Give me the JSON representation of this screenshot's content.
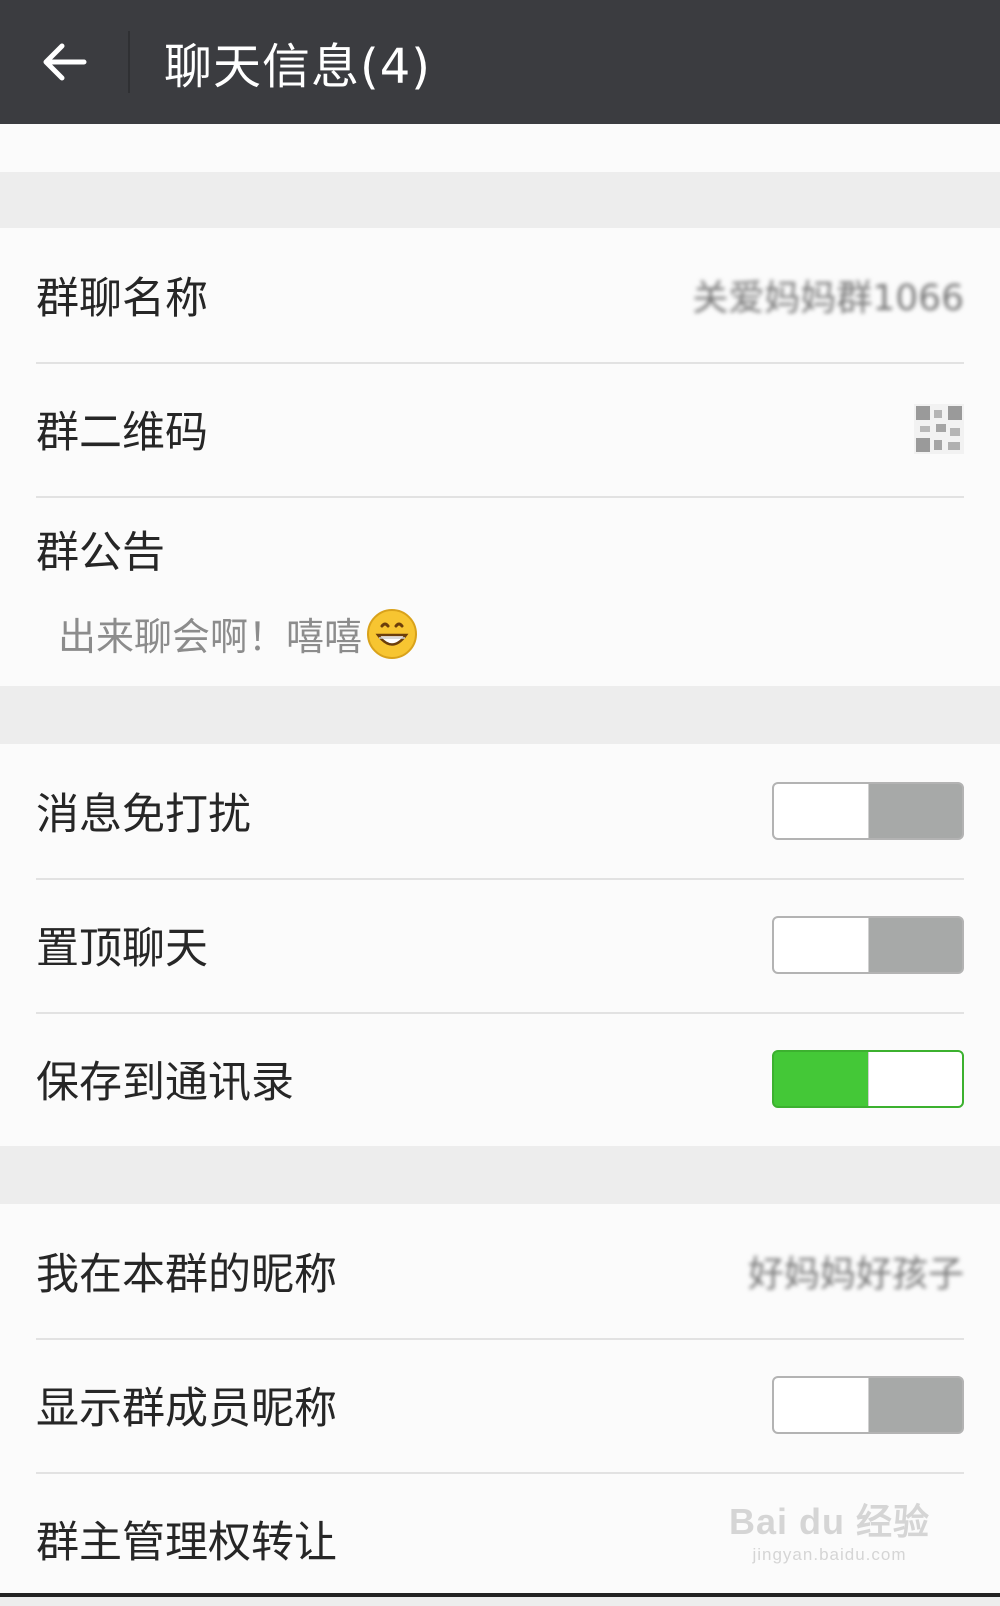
{
  "header": {
    "back_icon": "arrow-left-icon",
    "title": "聊天信息(4)"
  },
  "group_info": {
    "group_name_label": "群聊名称",
    "group_name_value": "关爱妈妈群1066",
    "qrcode_label": "群二维码",
    "qrcode_icon": "qrcode-icon",
    "announcement_label": "群公告",
    "announcement_text": "出来聊会啊！嘻嘻",
    "announcement_emoji": "grinning-face-icon"
  },
  "settings": {
    "mute_label": "消息免打扰",
    "mute_on": false,
    "pin_label": "置顶聊天",
    "pin_on": false,
    "save_contacts_label": "保存到通讯录",
    "save_contacts_on": true
  },
  "member": {
    "my_nickname_label": "我在本群的昵称",
    "my_nickname_value": "好妈妈好孩子",
    "show_nicknames_label": "显示群成员昵称",
    "show_nicknames_on": false,
    "transfer_owner_label": "群主管理权转让"
  },
  "watermark": {
    "brand": "Bai du 经验",
    "url": "jingyan.baidu.com"
  },
  "colors": {
    "topbar": "#3b3c40",
    "switch_on": "#44c837",
    "switch_off": "#a7a9a8",
    "background": "#ededed"
  }
}
